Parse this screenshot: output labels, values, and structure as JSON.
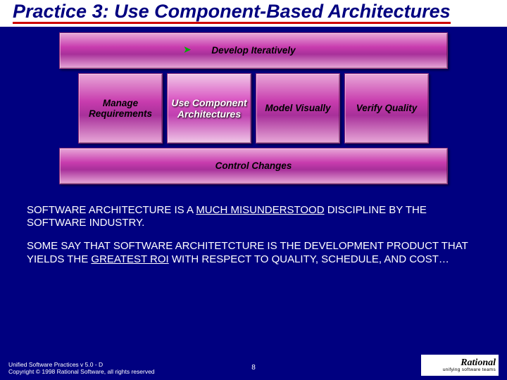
{
  "title": "Practice 3: Use Component-Based Architectures",
  "puzzle": {
    "top": "Develop Iteratively",
    "mid": {
      "a": "Manage Requirements",
      "b": "Use Component Architectures",
      "c": "Model Visually",
      "d": "Verify Quality"
    },
    "bottom": "Control Changes"
  },
  "body": {
    "p1_pre": "SOFTWARE ARCHITECTURE IS A ",
    "p1_u": "MUCH MISUNDERSTOOD",
    "p1_post": " DISCIPLINE BY THE SOFTWARE INDUSTRY.",
    "p2_pre": "SOME SAY THAT SOFTWARE ARCHITETCTURE IS THE DEVELOPMENT PRODUCT THAT YIELDS THE ",
    "p2_u": "GREATEST ROI",
    "p2_post": " WITH RESPECT TO QUALITY, SCHEDULE, AND COST…"
  },
  "footer": {
    "line1": "Unified Software Practices v 5.0 - D",
    "line2": "Copyright © 1998 Rational Software, all rights reserved",
    "page": "8",
    "logo_brand": "Rational",
    "logo_tag": "unifying software teams"
  }
}
